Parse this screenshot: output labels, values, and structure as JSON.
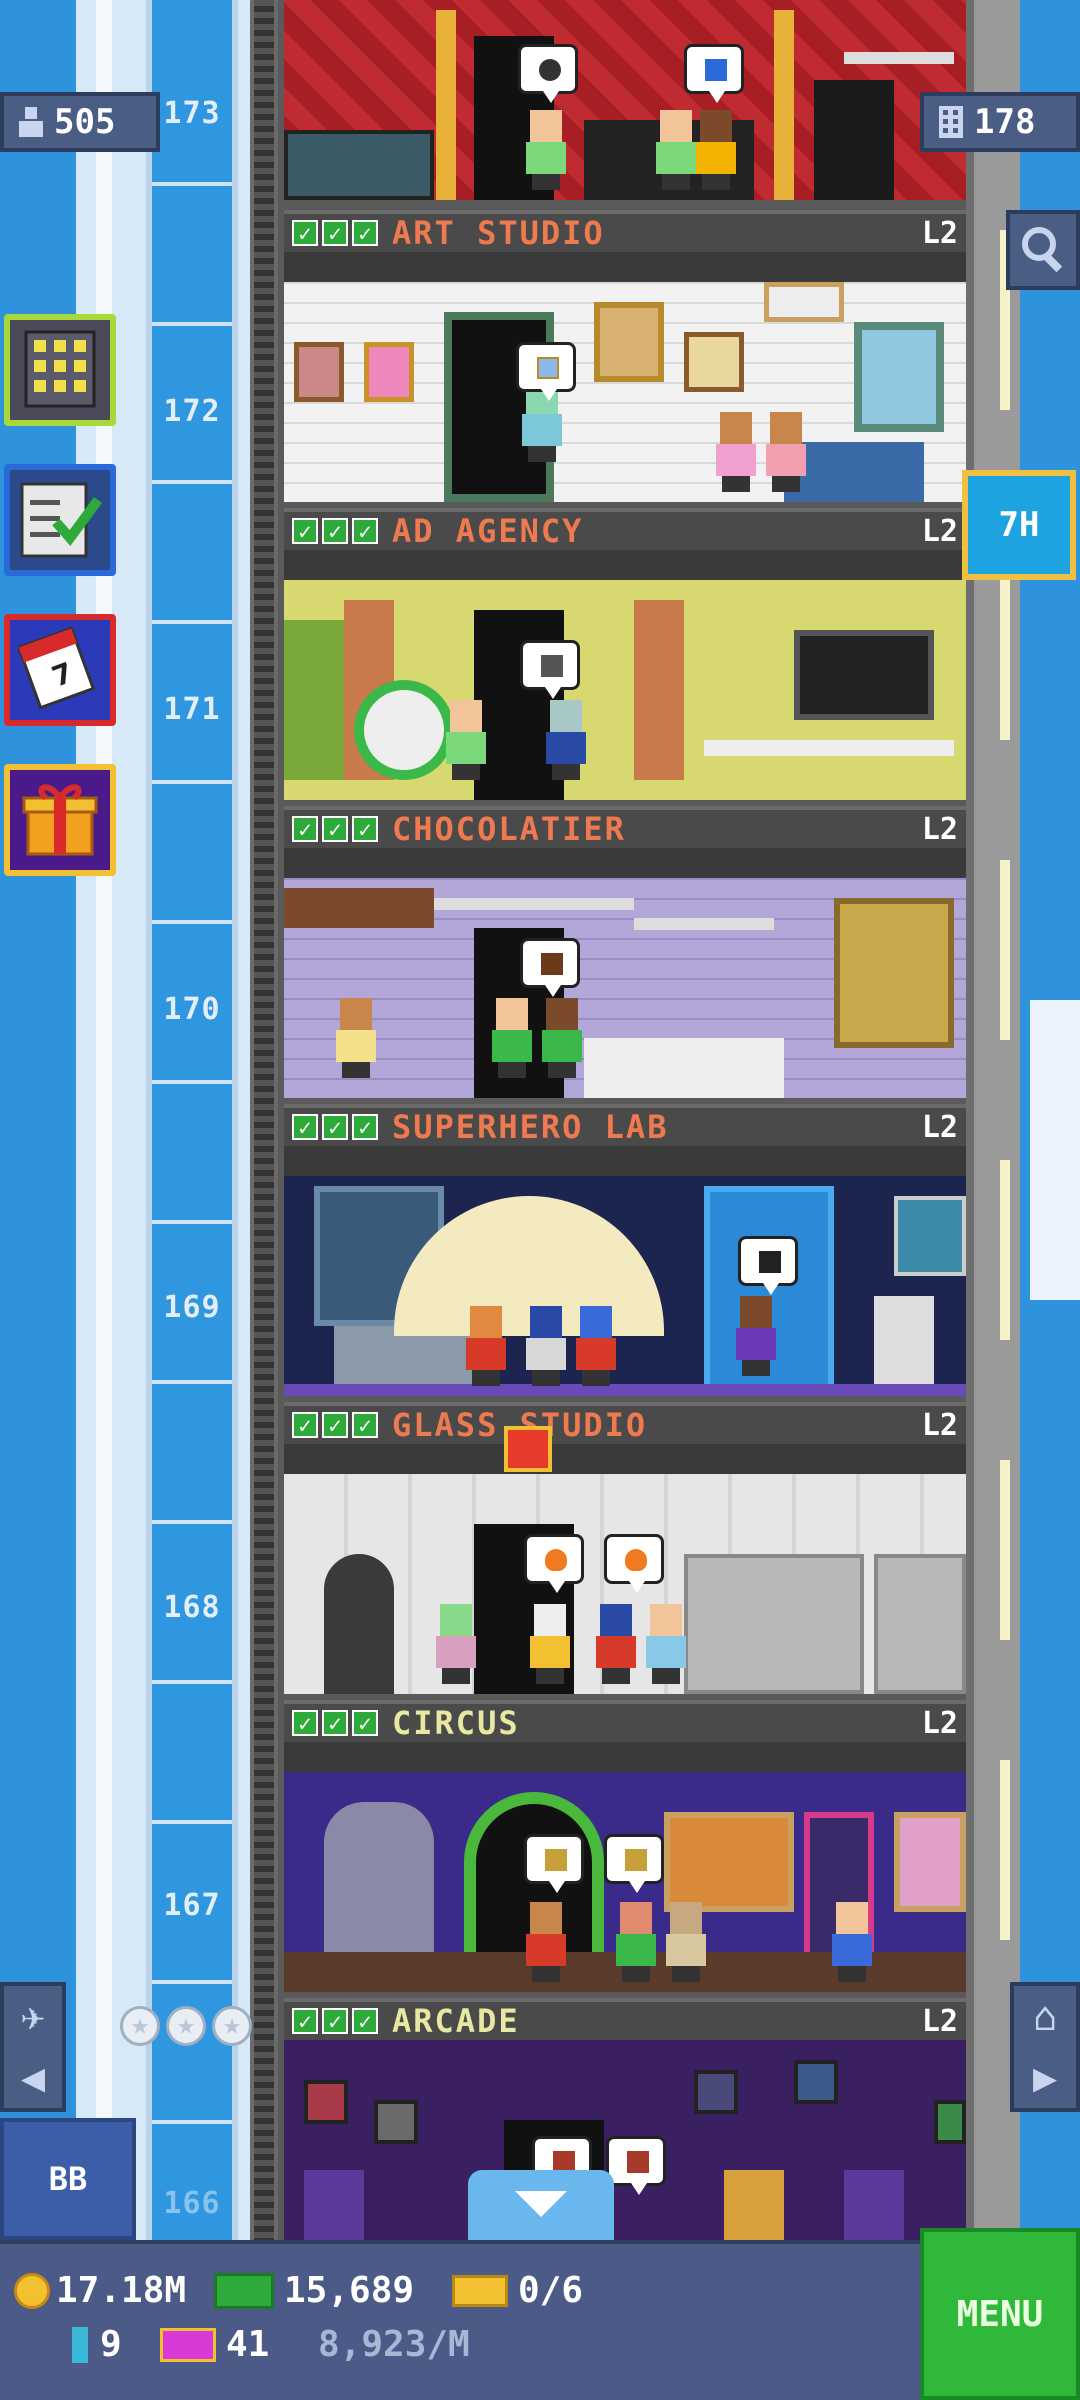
{
  "hud_top": {
    "population": "505",
    "floors": "178"
  },
  "shaft_floors": [
    "173",
    "172",
    "171",
    "170",
    "169",
    "168",
    "167",
    "166"
  ],
  "floors": [
    {
      "name": "ART STUDIO",
      "level": "L2",
      "color": "#f07a50"
    },
    {
      "name": "AD AGENCY",
      "level": "L2",
      "color": "#f07a50"
    },
    {
      "name": "CHOCOLATIER",
      "level": "L2",
      "color": "#f07a50"
    },
    {
      "name": "SUPERHERO LAB",
      "level": "L2",
      "color": "#f07a50"
    },
    {
      "name": "GLASS STUDIO",
      "level": "L2",
      "color": "#f07a50"
    },
    {
      "name": "CIRCUS",
      "level": "L2",
      "color": "#e8e8a0"
    },
    {
      "name": "ARCADE",
      "level": "L2",
      "color": "#e8e8a0"
    }
  ],
  "check_symbol": "✓",
  "timer_tab": "7H",
  "bb_button": "BB",
  "menu_button": "MENU",
  "hud": {
    "coins": "17.18M",
    "bux": "15,689",
    "tickets": "0/6",
    "keys": "9",
    "vip": "41",
    "income_rate": "8,923/M"
  },
  "icons": {
    "population": "person-icon",
    "floors": "building-icon",
    "search": "magnifier-icon",
    "coins": "coin-icon",
    "bux": "bux-icon",
    "tickets": "ticket-icon",
    "keys": "key-icon",
    "vip": "vip-icon"
  },
  "colors": {
    "sky": "#2e93dc",
    "hud": "#4b5a86",
    "menu": "#2fb83a",
    "timer_tab": "#1ca3e0"
  }
}
